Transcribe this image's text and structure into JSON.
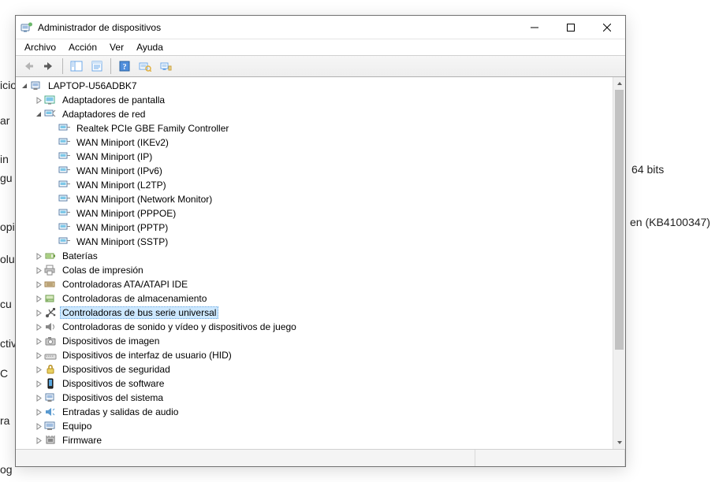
{
  "background": {
    "b0": "icio",
    "b1": "ar",
    "b2": "in",
    "b3": "gu",
    "b4": "opi",
    "b5": "olu",
    "b6": "cu",
    "b7": "ctiv",
    "b8": "C",
    "b9": "ra",
    "b10": "og",
    "b11": "64 bits",
    "b12": "en (KB4100347)"
  },
  "window": {
    "title": "Administrador de dispositivos"
  },
  "menu": {
    "file": "Archivo",
    "action": "Acción",
    "view": "Ver",
    "help": "Ayuda"
  },
  "tree": {
    "root": "LAPTOP-U56ADBK7",
    "display_adapters": "Adaptadores de pantalla",
    "network_adapters": "Adaptadores de red",
    "realtek": "Realtek PCIe GBE Family Controller",
    "wan_ikev2": "WAN Miniport (IKEv2)",
    "wan_ip": "WAN Miniport (IP)",
    "wan_ipv6": "WAN Miniport (IPv6)",
    "wan_l2tp": "WAN Miniport (L2TP)",
    "wan_netmon": "WAN Miniport (Network Monitor)",
    "wan_pppoe": "WAN Miniport (PPPOE)",
    "wan_pptp": "WAN Miniport (PPTP)",
    "wan_sstp": "WAN Miniport (SSTP)",
    "batteries": "Baterías",
    "print_queues": "Colas de impresión",
    "ata_controllers": "Controladoras ATA/ATAPI IDE",
    "storage_controllers": "Controladoras de almacenamiento",
    "usb_controllers": "Controladoras de bus serie universal",
    "sound_controllers": "Controladoras de sonido y vídeo y dispositivos de juego",
    "imaging_devices": "Dispositivos de imagen",
    "hid_devices": "Dispositivos de interfaz de usuario (HID)",
    "security_devices": "Dispositivos de seguridad",
    "software_devices": "Dispositivos de software",
    "system_devices": "Dispositivos del sistema",
    "audio_io": "Entradas y salidas de audio",
    "computer": "Equipo",
    "firmware": "Firmware"
  }
}
